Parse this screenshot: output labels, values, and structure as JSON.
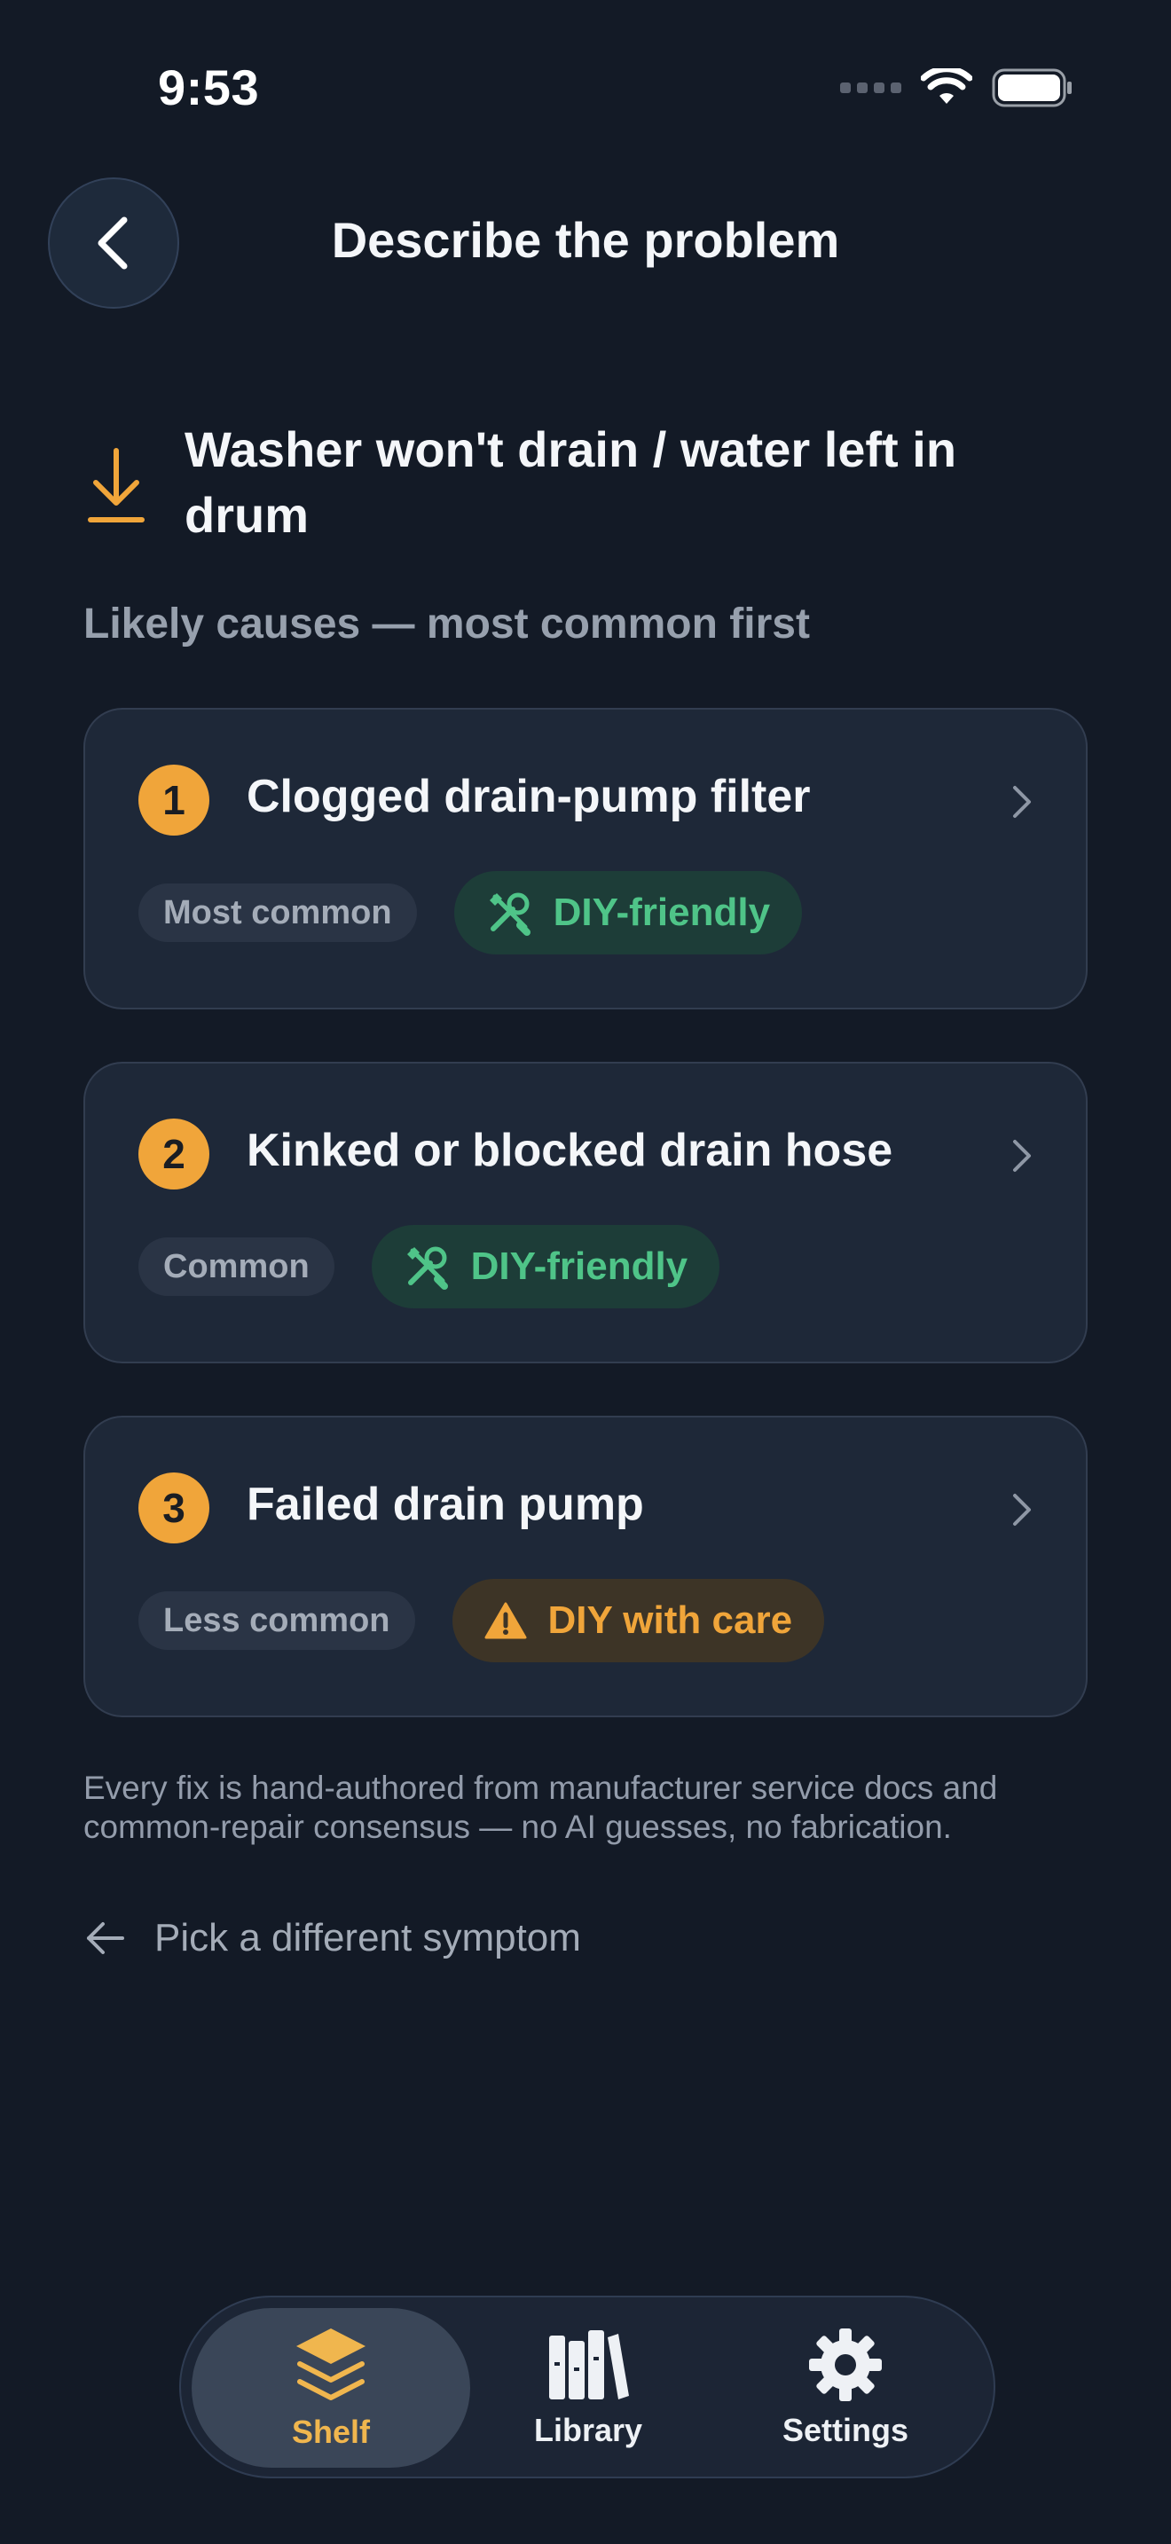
{
  "status_bar": {
    "time": "9:53"
  },
  "header": {
    "title": "Describe the problem"
  },
  "symptom": {
    "title": "Washer won't drain / water left in drum"
  },
  "section_label": "Likely causes — most common first",
  "causes": [
    {
      "rank": "1",
      "title": "Clogged drain-pump filter",
      "frequency": "Most common",
      "diy": "DIY-friendly",
      "diy_icon": "tools-icon"
    },
    {
      "rank": "2",
      "title": "Kinked or blocked drain hose",
      "frequency": "Common",
      "diy": "DIY-friendly",
      "diy_icon": "tools-icon"
    },
    {
      "rank": "3",
      "title": "Failed drain pump",
      "frequency": "Less common",
      "diy": "DIY with care",
      "diy_icon": "warning-icon"
    }
  ],
  "disclaimer": "Every fix is hand-authored from manufacturer service docs and common-repair consensus — no AI guesses, no fabrication.",
  "alt_link": "Pick a different symptom",
  "tabs": [
    {
      "label": "Shelf",
      "icon": "layers-icon",
      "active": true
    },
    {
      "label": "Library",
      "icon": "books-icon",
      "active": false
    },
    {
      "label": "Settings",
      "icon": "gear-icon",
      "active": false
    }
  ],
  "colors": {
    "background": "#131a26",
    "accent": "#f0a53a",
    "diy_green": "#4fc488",
    "card": "#1e2838"
  }
}
